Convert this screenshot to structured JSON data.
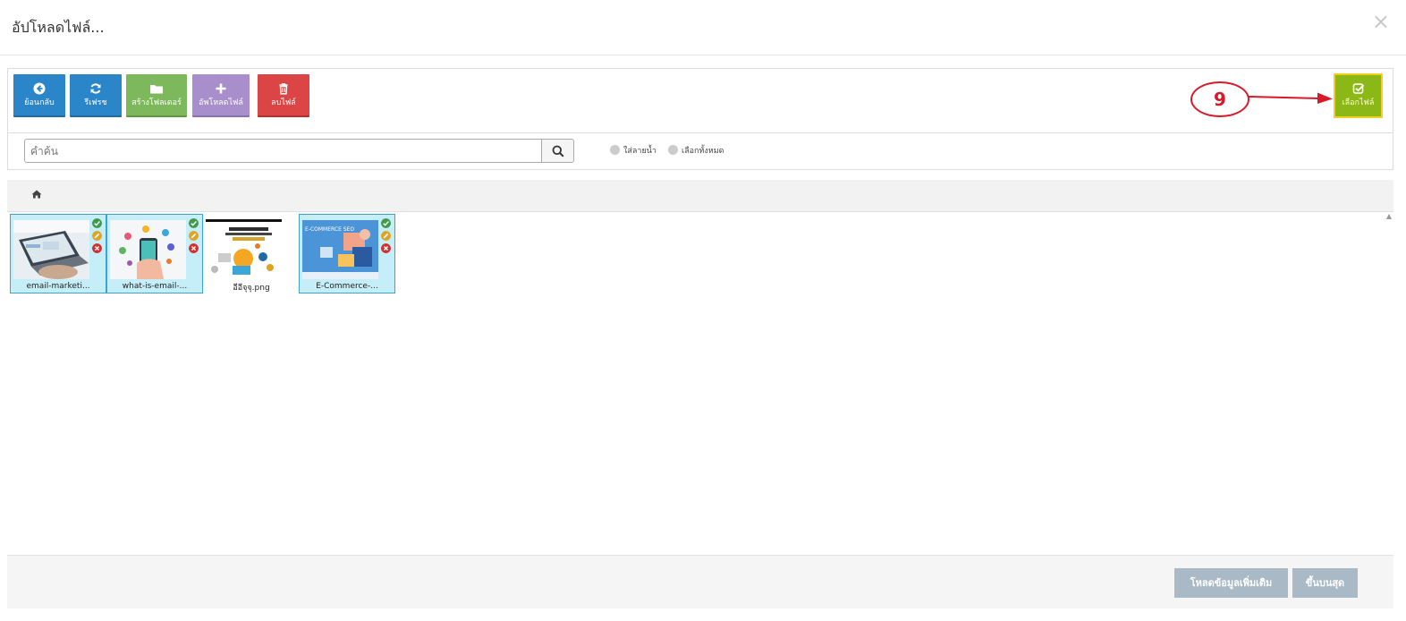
{
  "modal": {
    "title": "อัปโหลดไฟล์...",
    "close": "×"
  },
  "toolbar": {
    "back_label": "ย้อนกลับ",
    "refresh_label": "รีเฟรช",
    "new_folder_label": "สร้างโฟลเดอร์",
    "upload_label": "อัพโหลดไฟล์",
    "delete_label": "ลบไฟล์",
    "select_label": "เลือกไฟล์"
  },
  "annotation": {
    "number": "9"
  },
  "search": {
    "placeholder": "คำค้น",
    "value": "",
    "watermark_label": "ใส่ลายน้ำ",
    "select_all_label": "เลือกทั้งหมด"
  },
  "files": [
    {
      "name": "email-marketi...",
      "selected": true,
      "icon": "image-thumbnail"
    },
    {
      "name": "what-is-email-...",
      "selected": true,
      "icon": "image-thumbnail"
    },
    {
      "name": "อีอีจุจุ.png",
      "selected": false,
      "icon": "image-thumbnail"
    },
    {
      "name": "E-Commerce-...",
      "selected": true,
      "icon": "image-thumbnail"
    }
  ],
  "footer": {
    "load_more_label": "โหลดข้อมูลเพิ่มเติม",
    "scroll_top_label": "ขึ้นบนสุด"
  },
  "colors": {
    "primary_blue": "#2b86c9",
    "green": "#7db85c",
    "purple": "#a88fcc",
    "red": "#dc4545",
    "select_green": "#8bb816",
    "selected_bg": "#c5eef9",
    "annotation_red": "#d8192a"
  }
}
